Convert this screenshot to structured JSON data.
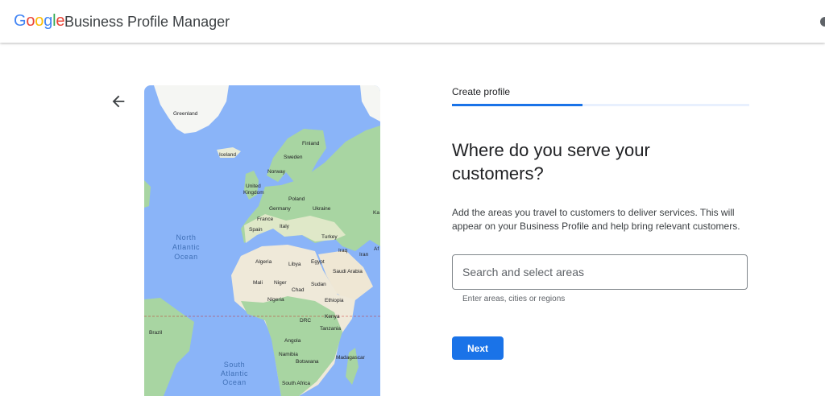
{
  "header": {
    "logo_letters": [
      "G",
      "o",
      "o",
      "g",
      "l",
      "e"
    ],
    "app_name": "Business Profile Manager"
  },
  "map": {
    "labels": {
      "greenland": "Greenland",
      "iceland": "Iceland",
      "finland": "Finland",
      "sweden": "Sweden",
      "norway": "Norway",
      "united": "United",
      "kingdom": "Kingdom",
      "poland": "Poland",
      "germany": "Germany",
      "ukraine": "Ukraine",
      "france": "France",
      "spain": "Spain",
      "italy": "Italy",
      "turkey": "Turkey",
      "iraq": "Iraq",
      "iran": "Iran",
      "algeria": "Algeria",
      "libya": "Libya",
      "egypt": "Egypt",
      "saudi_arabia": "Saudi Arabia",
      "mali": "Mali",
      "niger": "Niger",
      "chad": "Chad",
      "sudan": "Sudan",
      "nigeria": "Nigeria",
      "ethiopia": "Ethiopia",
      "drc": "DRC",
      "kenya": "Kenya",
      "tanzania": "Tanzania",
      "brazil": "Brazil",
      "angola": "Angola",
      "namibia": "Namibia",
      "botswana": "Botswana",
      "madagascar": "Madagascar",
      "south_africa": "South Africa",
      "ka": "Ka",
      "af": "Af",
      "north_atlantic_1": "North",
      "north_atlantic_2": "Atlantic",
      "north_atlantic_3": "Ocean",
      "south_atlantic_1": "South",
      "south_atlantic_2": "Atlantic",
      "south_atlantic_3": "Ocean"
    }
  },
  "form": {
    "step_label": "Create profile",
    "progress": 0.44,
    "heading": "Where do you serve your customers?",
    "description": "Add the areas you travel to customers to deliver services. This will appear on your Business Profile and help bring relevant customers.",
    "search_placeholder": "Search and select areas",
    "search_value": "",
    "helper_text": "Enter areas, cities or regions",
    "next_label": "Next"
  },
  "colors": {
    "accent": "#1a73e8",
    "ocean": "#8ab4f8",
    "land": "#e9ecd8",
    "forest": "#a8d5a2"
  },
  "icons": {
    "back": "arrow-back-icon"
  }
}
